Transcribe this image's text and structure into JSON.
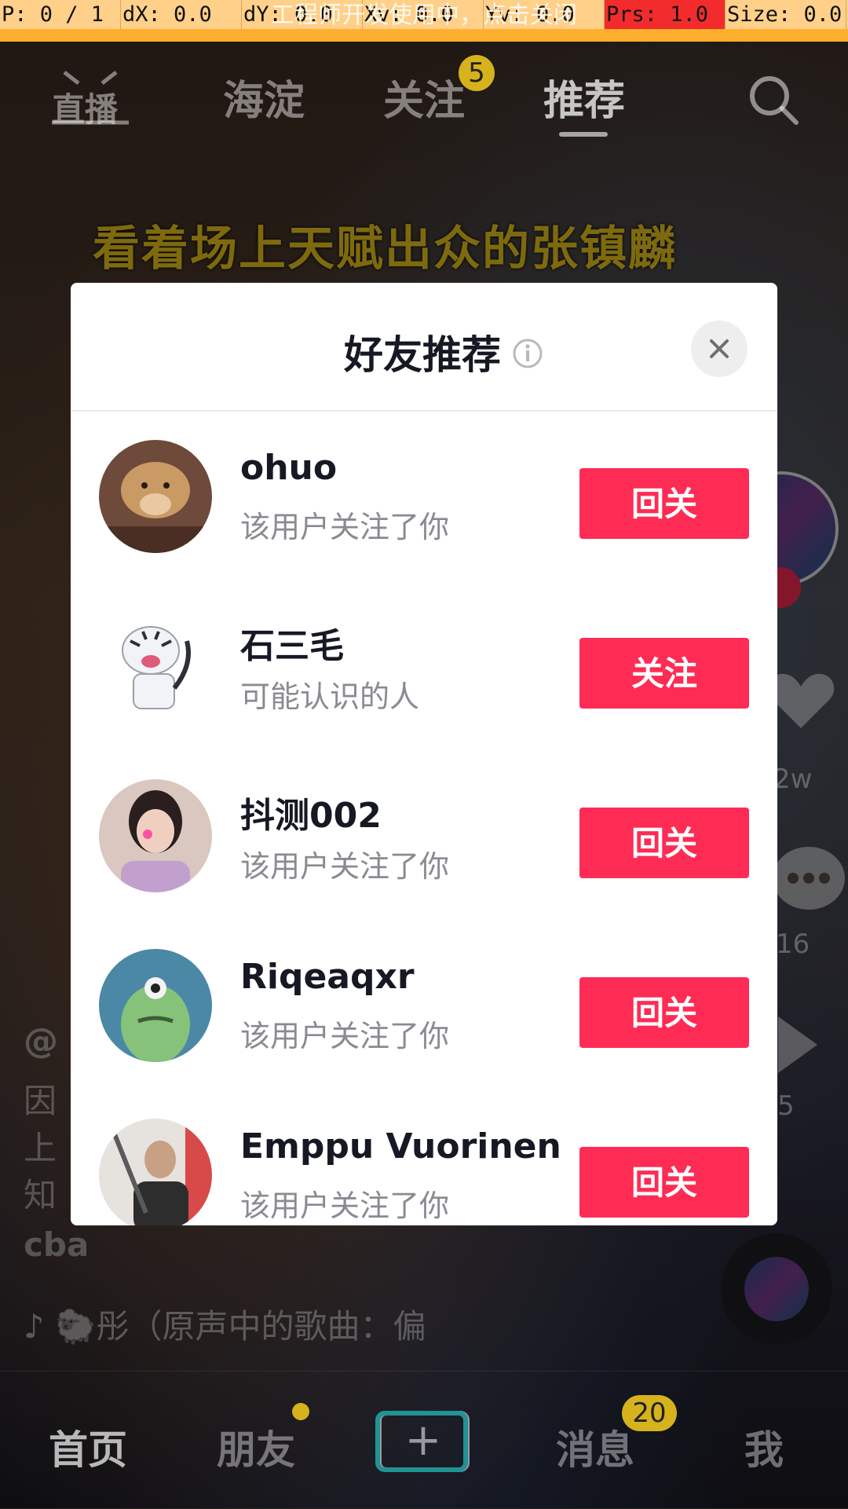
{
  "debug": {
    "cells": [
      "P: 0 / 1",
      "dX: 0.0",
      "dY: 0.0",
      "Xv: 0.0",
      "Yv: 0.0",
      "Prs: 1.0",
      "Size: 0.0"
    ],
    "overlay_text": "工程师开发使用中，点击关闭"
  },
  "top_nav": {
    "live_label": "直播",
    "tabs": [
      "海淀",
      "关注",
      "推荐"
    ],
    "follow_badge": "5",
    "active_tab": "推荐"
  },
  "video": {
    "caption": "看着场上天赋出众的张镇麟",
    "author": "@",
    "desc_lines": [
      "因",
      "上",
      "知"
    ],
    "tag": "cba",
    "music": "🐑彤（原声中的歌曲：偏",
    "like_count": "2w",
    "comment_count": "16",
    "share_count": "5"
  },
  "modal": {
    "title": "好友推荐",
    "users": [
      {
        "name": "ohuo",
        "subtitle": "该用户关注了你",
        "action": "回关",
        "avatar": "dog-avatar"
      },
      {
        "name": "石三毛",
        "subtitle": "可能认识的人",
        "action": "关注",
        "avatar": "tiger-avatar"
      },
      {
        "name": "抖测002",
        "subtitle": "该用户关注了你",
        "action": "回关",
        "avatar": "girl-avatar"
      },
      {
        "name": "Riqeaqxr",
        "subtitle": "该用户关注了你",
        "action": "回关",
        "avatar": "monster-avatar"
      },
      {
        "name": "Emppu Vuorinen",
        "subtitle": "该用户关注了你",
        "action": "回关",
        "avatar": "guitar-avatar"
      }
    ]
  },
  "tab_bar": {
    "tabs": [
      "首页",
      "朋友",
      "消息",
      "我"
    ],
    "message_badge": "20",
    "active": "首页"
  },
  "colors": {
    "accent": "#fe2c55",
    "badge": "#d6b21c",
    "debug_bg": "#ffd089"
  }
}
